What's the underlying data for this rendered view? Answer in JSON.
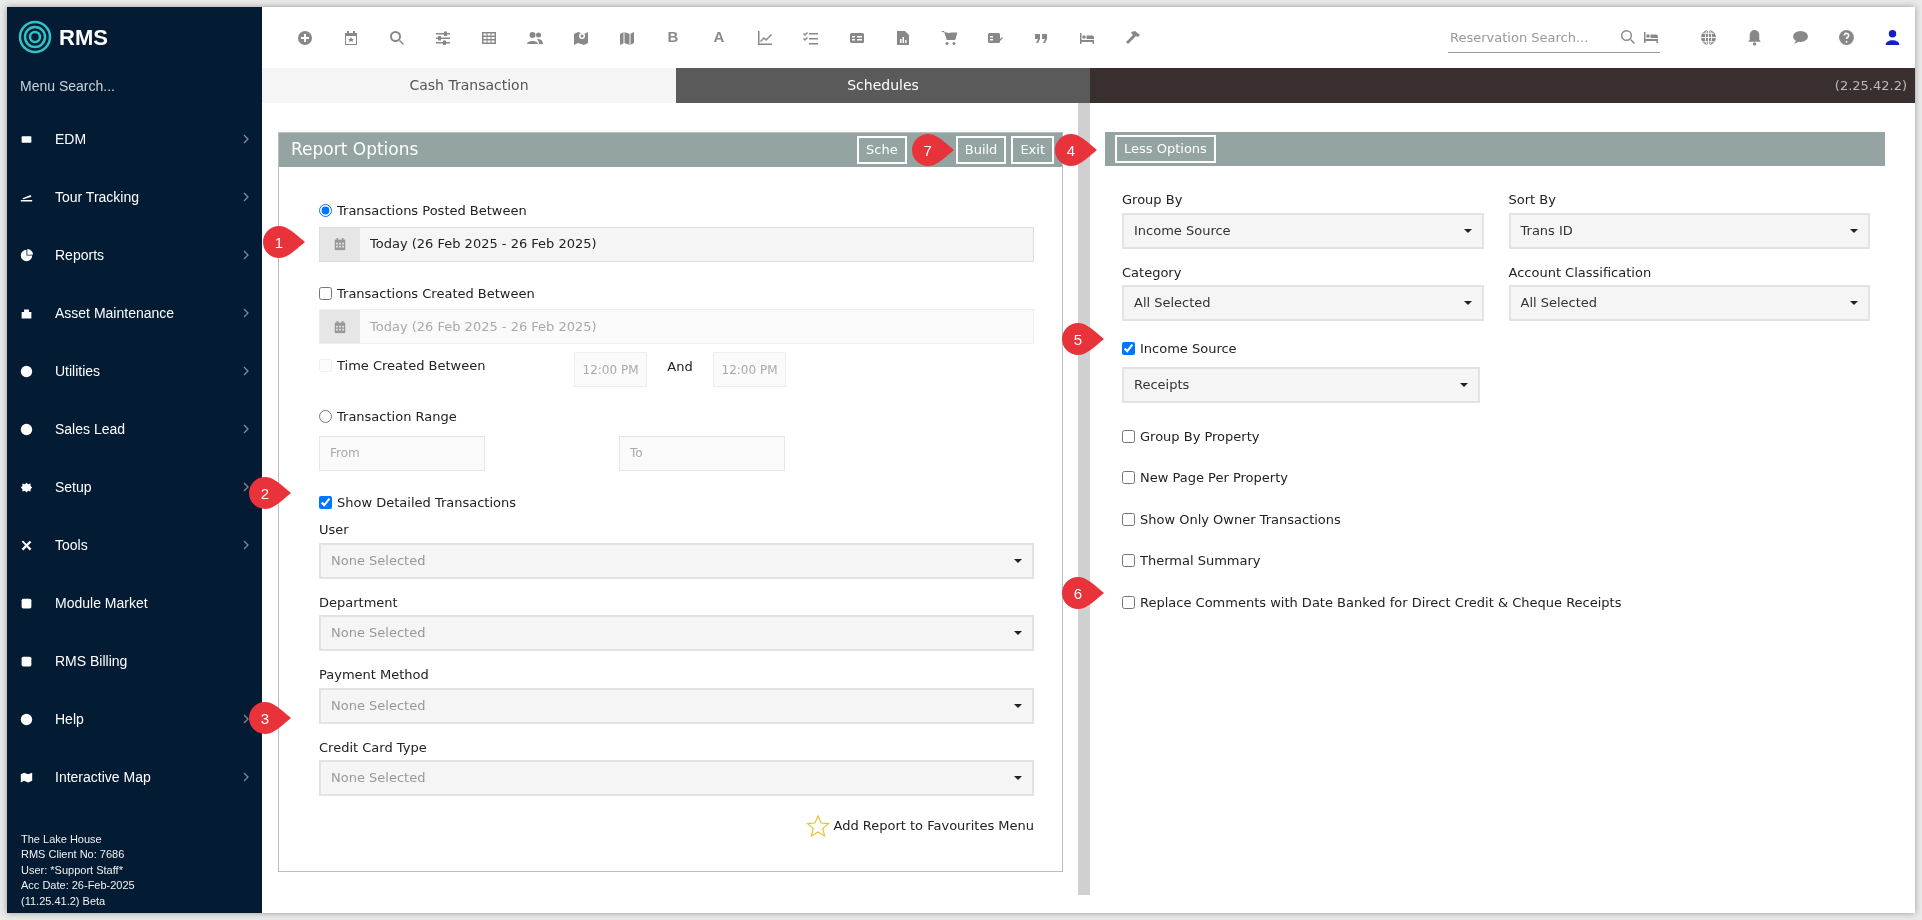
{
  "brand": {
    "name": "RMS"
  },
  "sidebar": {
    "search_placeholder": "Menu Search...",
    "items": [
      {
        "label": "EDM",
        "has_submenu": true
      },
      {
        "label": "Tour Tracking",
        "has_submenu": true
      },
      {
        "label": "Reports",
        "has_submenu": true
      },
      {
        "label": "Asset Maintenance",
        "has_submenu": true
      },
      {
        "label": "Utilities",
        "has_submenu": true
      },
      {
        "label": "Sales Lead",
        "has_submenu": true
      },
      {
        "label": "Setup",
        "has_submenu": true
      },
      {
        "label": "Tools",
        "has_submenu": true
      },
      {
        "label": "Module Market",
        "has_submenu": false
      },
      {
        "label": "RMS Billing",
        "has_submenu": false
      },
      {
        "label": "Help",
        "has_submenu": true
      },
      {
        "label": "Interactive Map",
        "has_submenu": true
      }
    ],
    "footer": [
      "The Lake House",
      "RMS Client No: 7686",
      "User: *Support Staff*",
      "Acc Date: 26-Feb-2025",
      "(11.25.41.2)  Beta"
    ]
  },
  "toolbar_letters": [
    "B",
    "A"
  ],
  "reservation_search": {
    "placeholder": "Reservation Search..."
  },
  "tabs": [
    {
      "label": "Cash Transaction",
      "selected": false
    },
    {
      "label": "Schedules",
      "selected": true
    }
  ],
  "version": "(2.25.42.2)",
  "report_options": {
    "title": "Report Options",
    "buttons": [
      {
        "label": "Sche"
      },
      {
        "label": "Build",
        "callout": "7"
      },
      {
        "label": "Exit"
      }
    ],
    "posted": {
      "label": "Transactions Posted Between",
      "selected": true,
      "value": "Today (26 Feb 2025 - 26 Feb 2025)",
      "callout": "1"
    },
    "created": {
      "label": "Transactions Created Between",
      "checked": false,
      "value": "Today (26 Feb 2025 - 26 Feb 2025)"
    },
    "time_created": {
      "label": "Time Created Between",
      "checked": false,
      "disabled": true,
      "from": "12:00 PM",
      "and": "And",
      "to": "12:00 PM"
    },
    "range": {
      "label": "Transaction Range",
      "selected": false,
      "from_placeholder": "From",
      "to_placeholder": "To"
    },
    "show_detailed": {
      "label": "Show Detailed Transactions",
      "checked": true,
      "callout": "2"
    },
    "selects": [
      {
        "label": "User",
        "value": "None Selected"
      },
      {
        "label": "Department",
        "value": "None Selected"
      },
      {
        "label": "Payment Method",
        "value": "None Selected",
        "callout": "3"
      },
      {
        "label": "Credit Card Type",
        "value": "None Selected"
      }
    ],
    "favourite": "Add Report to Favourites Menu"
  },
  "more_options": {
    "button": {
      "label": "Less Options",
      "callout": "4"
    },
    "selects": [
      {
        "label": "Group By",
        "value": "Income Source"
      },
      {
        "label": "Sort By",
        "value": "Trans ID"
      },
      {
        "label": "Category",
        "value": "All Selected"
      },
      {
        "label": "Account Classification",
        "value": "All Selected"
      }
    ],
    "income_source": {
      "label": "Income Source",
      "checked": true,
      "value": "Receipts",
      "callout": "5"
    },
    "checkboxes": [
      {
        "label": "Group By Property",
        "checked": false
      },
      {
        "label": "New Page Per Property",
        "checked": false
      },
      {
        "label": "Show Only Owner Transactions",
        "checked": false
      },
      {
        "label": "Thermal Summary",
        "checked": false
      },
      {
        "label": "Replace Comments with Date Banked for Direct Credit & Cheque Receipts",
        "checked": false,
        "callout": "6"
      }
    ]
  }
}
